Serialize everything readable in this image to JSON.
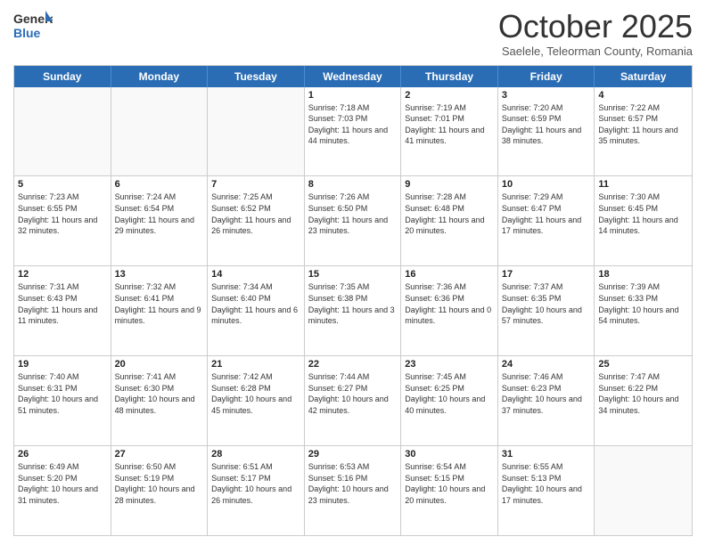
{
  "logo": {
    "general": "General",
    "blue": "Blue"
  },
  "header": {
    "month": "October 2025",
    "location": "Saelele, Teleorman County, Romania"
  },
  "days": [
    "Sunday",
    "Monday",
    "Tuesday",
    "Wednesday",
    "Thursday",
    "Friday",
    "Saturday"
  ],
  "rows": [
    [
      {
        "day": "",
        "empty": true
      },
      {
        "day": "",
        "empty": true
      },
      {
        "day": "",
        "empty": true
      },
      {
        "day": "1",
        "sunrise": "7:18 AM",
        "sunset": "7:03 PM",
        "daylight": "11 hours and 44 minutes."
      },
      {
        "day": "2",
        "sunrise": "7:19 AM",
        "sunset": "7:01 PM",
        "daylight": "11 hours and 41 minutes."
      },
      {
        "day": "3",
        "sunrise": "7:20 AM",
        "sunset": "6:59 PM",
        "daylight": "11 hours and 38 minutes."
      },
      {
        "day": "4",
        "sunrise": "7:22 AM",
        "sunset": "6:57 PM",
        "daylight": "11 hours and 35 minutes."
      }
    ],
    [
      {
        "day": "5",
        "sunrise": "7:23 AM",
        "sunset": "6:55 PM",
        "daylight": "11 hours and 32 minutes."
      },
      {
        "day": "6",
        "sunrise": "7:24 AM",
        "sunset": "6:54 PM",
        "daylight": "11 hours and 29 minutes."
      },
      {
        "day": "7",
        "sunrise": "7:25 AM",
        "sunset": "6:52 PM",
        "daylight": "11 hours and 26 minutes."
      },
      {
        "day": "8",
        "sunrise": "7:26 AM",
        "sunset": "6:50 PM",
        "daylight": "11 hours and 23 minutes."
      },
      {
        "day": "9",
        "sunrise": "7:28 AM",
        "sunset": "6:48 PM",
        "daylight": "11 hours and 20 minutes."
      },
      {
        "day": "10",
        "sunrise": "7:29 AM",
        "sunset": "6:47 PM",
        "daylight": "11 hours and 17 minutes."
      },
      {
        "day": "11",
        "sunrise": "7:30 AM",
        "sunset": "6:45 PM",
        "daylight": "11 hours and 14 minutes."
      }
    ],
    [
      {
        "day": "12",
        "sunrise": "7:31 AM",
        "sunset": "6:43 PM",
        "daylight": "11 hours and 11 minutes."
      },
      {
        "day": "13",
        "sunrise": "7:32 AM",
        "sunset": "6:41 PM",
        "daylight": "11 hours and 9 minutes."
      },
      {
        "day": "14",
        "sunrise": "7:34 AM",
        "sunset": "6:40 PM",
        "daylight": "11 hours and 6 minutes."
      },
      {
        "day": "15",
        "sunrise": "7:35 AM",
        "sunset": "6:38 PM",
        "daylight": "11 hours and 3 minutes."
      },
      {
        "day": "16",
        "sunrise": "7:36 AM",
        "sunset": "6:36 PM",
        "daylight": "11 hours and 0 minutes."
      },
      {
        "day": "17",
        "sunrise": "7:37 AM",
        "sunset": "6:35 PM",
        "daylight": "10 hours and 57 minutes."
      },
      {
        "day": "18",
        "sunrise": "7:39 AM",
        "sunset": "6:33 PM",
        "daylight": "10 hours and 54 minutes."
      }
    ],
    [
      {
        "day": "19",
        "sunrise": "7:40 AM",
        "sunset": "6:31 PM",
        "daylight": "10 hours and 51 minutes."
      },
      {
        "day": "20",
        "sunrise": "7:41 AM",
        "sunset": "6:30 PM",
        "daylight": "10 hours and 48 minutes."
      },
      {
        "day": "21",
        "sunrise": "7:42 AM",
        "sunset": "6:28 PM",
        "daylight": "10 hours and 45 minutes."
      },
      {
        "day": "22",
        "sunrise": "7:44 AM",
        "sunset": "6:27 PM",
        "daylight": "10 hours and 42 minutes."
      },
      {
        "day": "23",
        "sunrise": "7:45 AM",
        "sunset": "6:25 PM",
        "daylight": "10 hours and 40 minutes."
      },
      {
        "day": "24",
        "sunrise": "7:46 AM",
        "sunset": "6:23 PM",
        "daylight": "10 hours and 37 minutes."
      },
      {
        "day": "25",
        "sunrise": "7:47 AM",
        "sunset": "6:22 PM",
        "daylight": "10 hours and 34 minutes."
      }
    ],
    [
      {
        "day": "26",
        "sunrise": "6:49 AM",
        "sunset": "5:20 PM",
        "daylight": "10 hours and 31 minutes."
      },
      {
        "day": "27",
        "sunrise": "6:50 AM",
        "sunset": "5:19 PM",
        "daylight": "10 hours and 28 minutes."
      },
      {
        "day": "28",
        "sunrise": "6:51 AM",
        "sunset": "5:17 PM",
        "daylight": "10 hours and 26 minutes."
      },
      {
        "day": "29",
        "sunrise": "6:53 AM",
        "sunset": "5:16 PM",
        "daylight": "10 hours and 23 minutes."
      },
      {
        "day": "30",
        "sunrise": "6:54 AM",
        "sunset": "5:15 PM",
        "daylight": "10 hours and 20 minutes."
      },
      {
        "day": "31",
        "sunrise": "6:55 AM",
        "sunset": "5:13 PM",
        "daylight": "10 hours and 17 minutes."
      },
      {
        "day": "",
        "empty": true
      }
    ]
  ]
}
